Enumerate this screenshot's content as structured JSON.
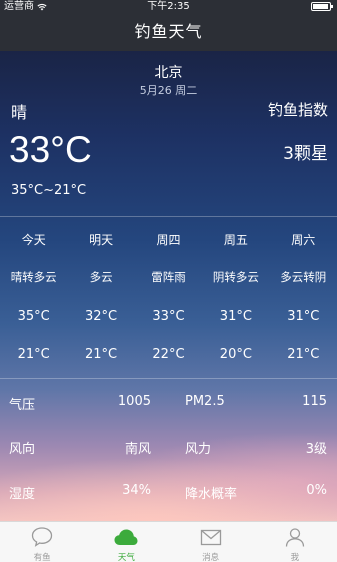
{
  "status_bar": {
    "carrier": "运营商",
    "time": "下午2:35"
  },
  "nav": {
    "title": "钓鱼天气"
  },
  "header": {
    "city": "北京",
    "date": "5月26 周二",
    "condition": "晴",
    "fishing_index_label": "钓鱼指数",
    "current_temp": "33°C",
    "fishing_index_value": "3颗星",
    "temp_range": "35°C~21°C"
  },
  "forecast": [
    {
      "day": "今天",
      "condition": "晴转多云",
      "high": "35°C",
      "low": "21°C"
    },
    {
      "day": "明天",
      "condition": "多云",
      "high": "32°C",
      "low": "21°C"
    },
    {
      "day": "周四",
      "condition": "雷阵雨",
      "high": "33°C",
      "low": "22°C"
    },
    {
      "day": "周五",
      "condition": "阴转多云",
      "high": "31°C",
      "low": "20°C"
    },
    {
      "day": "周六",
      "condition": "多云转阴",
      "high": "31°C",
      "low": "21°C"
    }
  ],
  "details": [
    {
      "label1": "气压",
      "value1": "1005",
      "label2": "PM2.5",
      "value2": "115"
    },
    {
      "label1": "风向",
      "value1": "南风",
      "label2": "风力",
      "value2": "3级"
    },
    {
      "label1": "湿度",
      "value1": "34%",
      "label2": "降水概率",
      "value2": "0%"
    }
  ],
  "tabs": [
    {
      "label": "有鱼",
      "icon": "chat-bubble-icon"
    },
    {
      "label": "天气",
      "icon": "cloud-icon",
      "active": true
    },
    {
      "label": "消息",
      "icon": "envelope-icon"
    },
    {
      "label": "我",
      "icon": "person-icon"
    }
  ],
  "colors": {
    "accent": "#3cab3c",
    "nav_bg": "#2c2f36",
    "tab_inactive": "#9a9a9a"
  }
}
